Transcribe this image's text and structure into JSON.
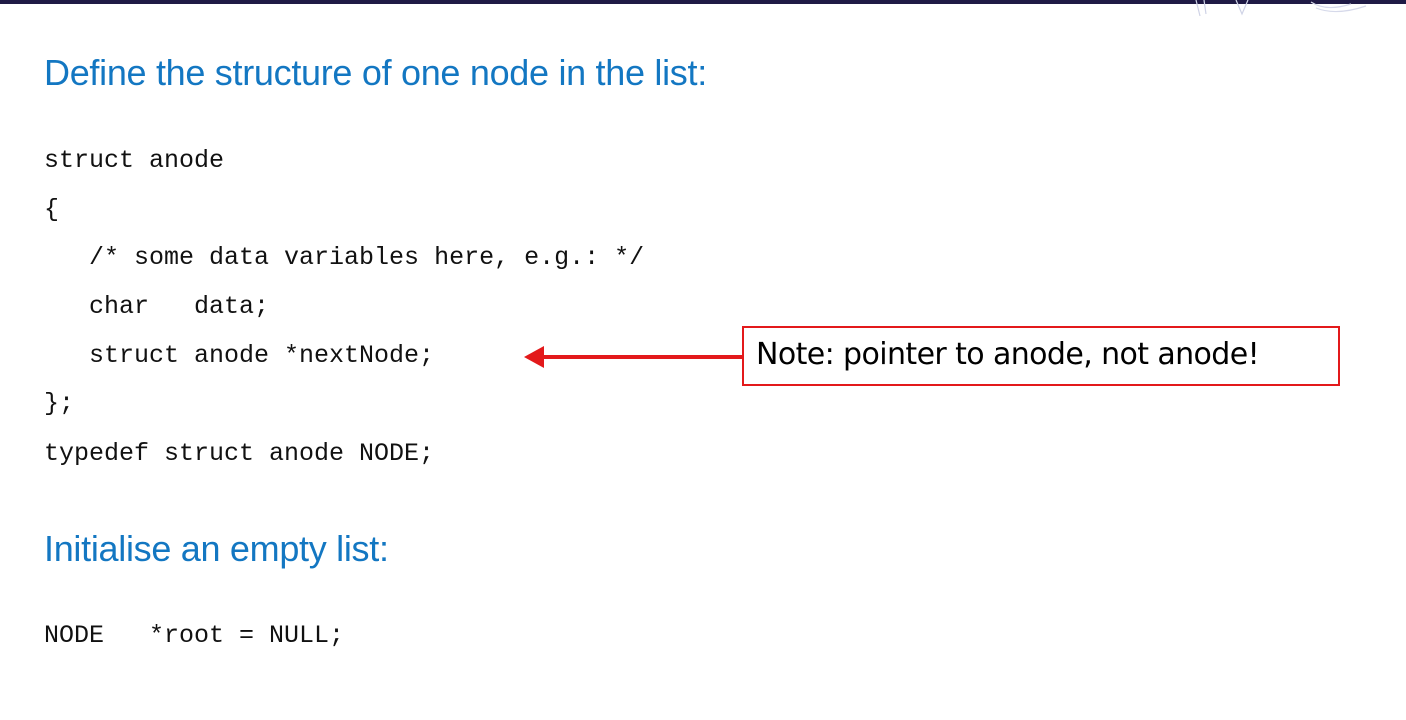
{
  "heading_1": "Define the structure of one node in the list:",
  "code_1": [
    "struct anode",
    "{",
    "   /* some data variables here, e.g.: */",
    "   char   data;",
    "   struct anode *nextNode;",
    "};",
    "typedef struct anode NODE;"
  ],
  "note": "Note: pointer to anode, not anode!",
  "heading_2": "Initialise an empty list:",
  "code_2": [
    "NODE   *root = NULL;"
  ],
  "colors": {
    "heading": "#1377c2",
    "note_border": "#e3191b",
    "arrow": "#e3191b",
    "top_bar": "#1f1a45"
  }
}
